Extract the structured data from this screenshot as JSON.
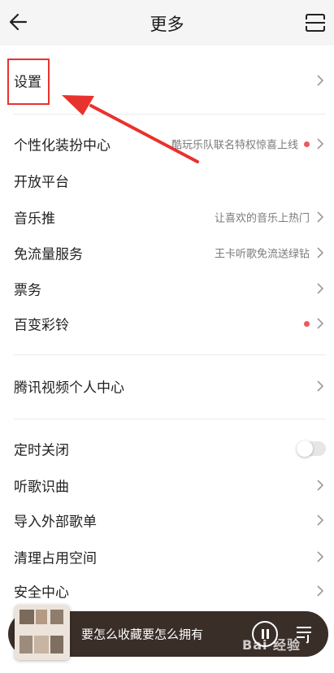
{
  "header": {
    "title": "更多"
  },
  "rows": [
    {
      "label": "设置",
      "hint": "",
      "dot": false
    },
    {
      "label": "个性化装扮中心",
      "hint": "酷玩乐队联名特权惊喜上线",
      "dot": true
    },
    {
      "label": "开放平台",
      "hint": "",
      "dot": false
    },
    {
      "label": "音乐推",
      "hint": "让喜欢的音乐上热门",
      "dot": false
    },
    {
      "label": "免流量服务",
      "hint": "王卡听歌免流送绿钻",
      "dot": false
    },
    {
      "label": "票务",
      "hint": "",
      "dot": false
    },
    {
      "label": "百变彩铃",
      "hint": "",
      "dot": true
    },
    {
      "label": "腾讯视频个人中心",
      "hint": "",
      "dot": false
    },
    {
      "label": "定时关闭",
      "hint": "",
      "toggle": false
    },
    {
      "label": "听歌识曲",
      "hint": ""
    },
    {
      "label": "导入外部歌单",
      "hint": ""
    },
    {
      "label": "清理占用空间",
      "hint": ""
    },
    {
      "label": "安全中心",
      "hint": ""
    }
  ],
  "player": {
    "song_title": "要怎么收藏要怎么拥有"
  },
  "watermark": {
    "text": "Bai 经验"
  },
  "icons": {
    "back": "back-arrow-icon",
    "scan": "scan-icon",
    "chevron": "chevron-right-icon",
    "pause": "pause-icon",
    "playlist": "playlist-icon"
  },
  "colors": {
    "accent_red": "#e8322e",
    "badge_dot": "#f0565b",
    "player_bg": "#3a2e28"
  }
}
